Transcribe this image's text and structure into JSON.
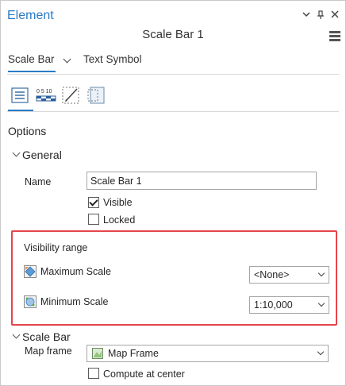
{
  "pane": {
    "title": "Element",
    "element_name": "Scale Bar 1"
  },
  "tabs": {
    "scale_bar": "Scale Bar",
    "text_symbol": "Text Symbol"
  },
  "options_heading": "Options",
  "general": {
    "heading": "General",
    "name_label": "Name",
    "name_value": "Scale Bar 1",
    "visible_label": "Visible",
    "visible_checked": true,
    "locked_label": "Locked",
    "locked_checked": false
  },
  "visibility_range": {
    "heading": "Visibility range",
    "max_label": "Maximum Scale",
    "max_value": "<None>",
    "min_label": "Minimum Scale",
    "min_value": "1:10,000"
  },
  "scale_bar_section": {
    "heading": "Scale Bar",
    "map_frame_label": "Map frame",
    "map_frame_value": "Map Frame",
    "compute_label": "Compute at center",
    "compute_checked": false
  },
  "icon_names": [
    "options-icon",
    "scale-bar-properties-icon",
    "display-icon",
    "placement-icon"
  ],
  "colors": {
    "accent": "#2a7bc4",
    "highlight_border": "#e5454a"
  }
}
